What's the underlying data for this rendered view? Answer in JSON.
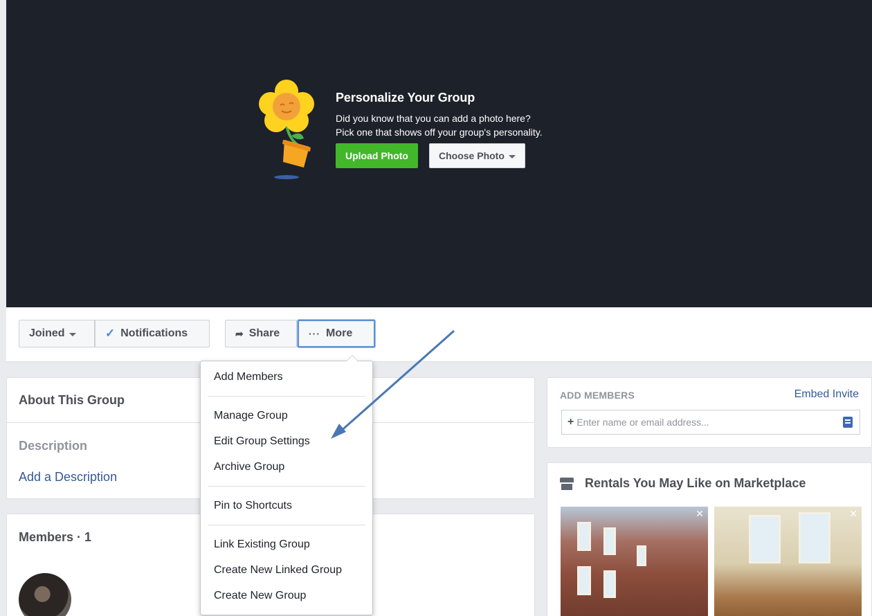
{
  "cover": {
    "title": "Personalize Your Group",
    "line1": "Did you know that you can add a photo here?",
    "line2": "Pick one that shows off your group's personality.",
    "upload_label": "Upload Photo",
    "choose_label": "Choose Photo"
  },
  "actions": {
    "joined": "Joined",
    "notifications": "Notifications",
    "share": "Share",
    "more": "More"
  },
  "menu": {
    "items": [
      "Add Members",
      "Manage Group",
      "Edit Group Settings",
      "Archive Group",
      "Pin to Shortcuts",
      "Link Existing Group",
      "Create New Linked Group",
      "Create New Group"
    ]
  },
  "about": {
    "title": "About This Group",
    "description_label": "Description",
    "add_description": "Add a Description"
  },
  "members": {
    "title": "Members · 1"
  },
  "add_members": {
    "title": "ADD MEMBERS",
    "embed_invite": "Embed Invite",
    "placeholder": "Enter name or email address..."
  },
  "rentals": {
    "title": "Rentals You May Like on Marketplace"
  },
  "colors": {
    "cover_bg": "#1d2129",
    "upload_green": "#42b72a",
    "link_blue": "#365899",
    "arrow_blue": "#4a77b4"
  },
  "icons": [
    "flower-illustration",
    "caret-down-icon",
    "check-icon",
    "share-icon",
    "more-dots-icon",
    "plus-icon",
    "note-icon",
    "store-icon",
    "close-icon",
    "annotation-arrow"
  ]
}
